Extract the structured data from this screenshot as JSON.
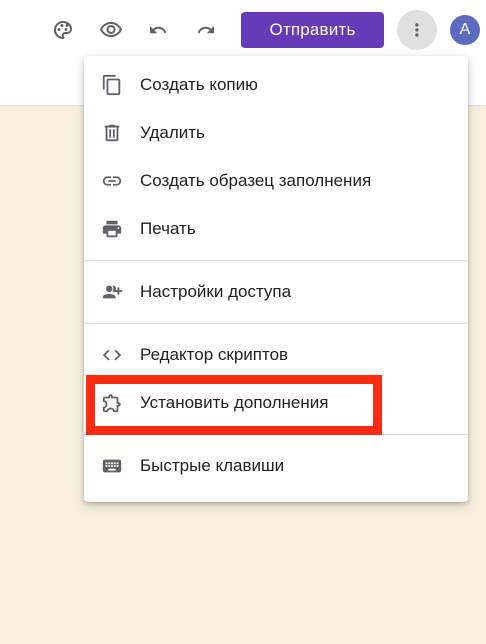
{
  "toolbar": {
    "icons": [
      "palette-icon",
      "eye-icon",
      "undo-icon",
      "redo-icon",
      "more-vert-icon"
    ],
    "send_label": "Отправить",
    "avatar_letter": "A",
    "accent_color": "#673ab7"
  },
  "menu": {
    "items": [
      {
        "label": "Создать копию",
        "icon": "copy-icon"
      },
      {
        "label": "Удалить",
        "icon": "trash-icon"
      },
      {
        "label": "Создать образец заполнения",
        "icon": "link-icon"
      },
      {
        "label": "Печать",
        "icon": "print-icon"
      },
      {
        "label": "Настройки доступа",
        "icon": "add-person-icon"
      },
      {
        "label": "Редактор скриптов",
        "icon": "code-icon"
      },
      {
        "label": "Установить дополнения",
        "icon": "puzzle-icon"
      },
      {
        "label": "Быстрые клавиши",
        "icon": "keyboard-icon"
      }
    ],
    "highlighted_item": "Установить дополнения",
    "highlight_color": "#ff2a12"
  },
  "background_color": "#f8f0dd"
}
